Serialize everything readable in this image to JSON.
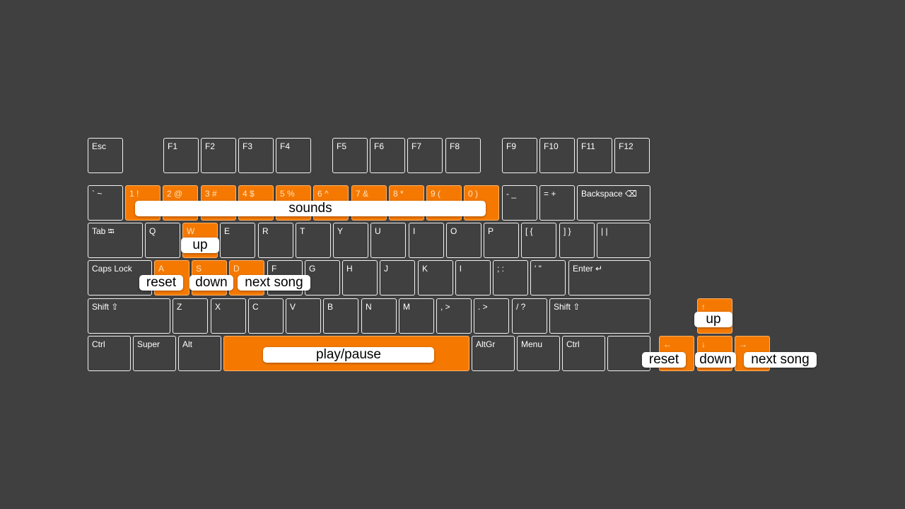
{
  "keys": [
    {
      "id": "esc",
      "text": "Esc"
    },
    {
      "id": "f1",
      "text": "F1"
    },
    {
      "id": "f2",
      "text": "F2"
    },
    {
      "id": "f3",
      "text": "F3"
    },
    {
      "id": "f4",
      "text": "F4"
    },
    {
      "id": "f5",
      "text": "F5"
    },
    {
      "id": "f6",
      "text": "F6"
    },
    {
      "id": "f7",
      "text": "F7"
    },
    {
      "id": "f8",
      "text": "F8"
    },
    {
      "id": "f9",
      "text": "F9"
    },
    {
      "id": "f10",
      "text": "F10"
    },
    {
      "id": "f11",
      "text": "F11"
    },
    {
      "id": "f12",
      "text": "F12"
    },
    {
      "id": "backtick",
      "text": "` ~"
    },
    {
      "id": "1",
      "text": "1 !",
      "highlighted": true
    },
    {
      "id": "2",
      "text": "2 @",
      "highlighted": true
    },
    {
      "id": "3",
      "text": "3 #",
      "highlighted": true
    },
    {
      "id": "4",
      "text": "4 $",
      "highlighted": true
    },
    {
      "id": "5",
      "text": "5 %",
      "highlighted": true
    },
    {
      "id": "6",
      "text": "6 ^",
      "highlighted": true
    },
    {
      "id": "7",
      "text": "7 &",
      "highlighted": true
    },
    {
      "id": "8",
      "text": "8 *",
      "highlighted": true
    },
    {
      "id": "9",
      "text": "9 (",
      "highlighted": true
    },
    {
      "id": "0",
      "text": "0 )",
      "highlighted": true
    },
    {
      "id": "minus",
      "text": "- _"
    },
    {
      "id": "equals",
      "text": "= +"
    },
    {
      "id": "backspace",
      "text": "Backspace ⌫"
    },
    {
      "id": "tab",
      "text": "Tab ⭾"
    },
    {
      "id": "q",
      "text": "Q"
    },
    {
      "id": "w",
      "text": "W",
      "highlighted": true
    },
    {
      "id": "e",
      "text": "E"
    },
    {
      "id": "r",
      "text": "R"
    },
    {
      "id": "t",
      "text": "T"
    },
    {
      "id": "y",
      "text": "Y"
    },
    {
      "id": "u",
      "text": "U"
    },
    {
      "id": "i",
      "text": "I"
    },
    {
      "id": "o",
      "text": "O"
    },
    {
      "id": "p",
      "text": "P"
    },
    {
      "id": "lbracket",
      "text": "[ {"
    },
    {
      "id": "rbracket",
      "text": "] }"
    },
    {
      "id": "backslash",
      "text": "| |"
    },
    {
      "id": "capslock",
      "text": "Caps Lock"
    },
    {
      "id": "a",
      "text": "A",
      "highlighted": true
    },
    {
      "id": "s",
      "text": "S",
      "highlighted": true
    },
    {
      "id": "d",
      "text": "D",
      "highlighted": true
    },
    {
      "id": "f",
      "text": "F"
    },
    {
      "id": "g",
      "text": "G"
    },
    {
      "id": "h",
      "text": "H"
    },
    {
      "id": "j",
      "text": "J"
    },
    {
      "id": "k",
      "text": "K"
    },
    {
      "id": "l",
      "text": "l"
    },
    {
      "id": "semicolon",
      "text": "; :"
    },
    {
      "id": "quote",
      "text": "' \""
    },
    {
      "id": "enter",
      "text": "Enter ↵"
    },
    {
      "id": "lshift",
      "text": "Shift ⇧"
    },
    {
      "id": "z",
      "text": "Z"
    },
    {
      "id": "x",
      "text": "X"
    },
    {
      "id": "c",
      "text": "C"
    },
    {
      "id": "v",
      "text": "V"
    },
    {
      "id": "b",
      "text": "B"
    },
    {
      "id": "n",
      "text": "N"
    },
    {
      "id": "m",
      "text": "M"
    },
    {
      "id": "comma",
      "text": ", >"
    },
    {
      "id": "period",
      "text": ". >"
    },
    {
      "id": "slash",
      "text": "/ ?"
    },
    {
      "id": "rshift",
      "text": "Shift ⇧"
    },
    {
      "id": "lctrl",
      "text": "Ctrl"
    },
    {
      "id": "super",
      "text": "Super"
    },
    {
      "id": "alt",
      "text": "Alt"
    },
    {
      "id": "space",
      "text": "",
      "highlighted": true
    },
    {
      "id": "altgr",
      "text": "AltGr"
    },
    {
      "id": "menu",
      "text": "Menu"
    },
    {
      "id": "rctrl",
      "text": "Ctrl"
    },
    {
      "id": "blank",
      "text": ""
    },
    {
      "id": "arrow-up",
      "text": "↑",
      "highlighted": true
    },
    {
      "id": "arrow-left",
      "text": "←",
      "highlighted": true
    },
    {
      "id": "arrow-down",
      "text": "↓",
      "highlighted": true
    },
    {
      "id": "arrow-right",
      "text": "→",
      "highlighted": true
    }
  ],
  "labels": [
    {
      "id": "sounds",
      "text": "sounds"
    },
    {
      "id": "w-up",
      "text": "up"
    },
    {
      "id": "a-reset",
      "text": "reset"
    },
    {
      "id": "s-down",
      "text": "down"
    },
    {
      "id": "d-next",
      "text": "next song"
    },
    {
      "id": "space-play",
      "text": "play/pause"
    },
    {
      "id": "arrow-up-label",
      "text": "up"
    },
    {
      "id": "arrow-left-reset",
      "text": "reset"
    },
    {
      "id": "arrow-down-label",
      "text": "down"
    },
    {
      "id": "arrow-right-next",
      "text": "next song"
    }
  ],
  "colors": {
    "background": "#404040",
    "highlight": "#f57900",
    "key_border": "#f2f2f2",
    "label_bg": "#ffffff"
  }
}
